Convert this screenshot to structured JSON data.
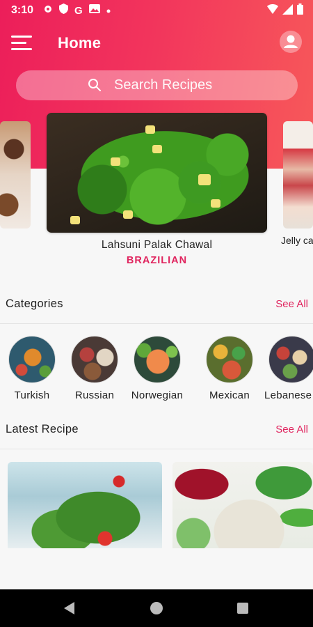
{
  "status_bar": {
    "time": "3:10",
    "icons": [
      "gear-icon",
      "shield-icon",
      "google-icon",
      "image-icon",
      "dot-icon",
      "wifi-icon",
      "signal-icon",
      "battery-icon"
    ]
  },
  "app_bar": {
    "title": "Home"
  },
  "search": {
    "placeholder": "Search Recipes"
  },
  "featured": {
    "current": {
      "name": "Lahsuni Palak Chawal",
      "cuisine": "BRAZILIAN"
    },
    "next": {
      "name": "Jelly cake"
    }
  },
  "categories_section": {
    "title": "Categories",
    "see_all": "See All",
    "items": [
      {
        "label": "Turkish"
      },
      {
        "label": "Russian"
      },
      {
        "label": "Norwegian"
      },
      {
        "label": "Mexican"
      },
      {
        "label": "Lebanese"
      }
    ]
  },
  "latest_section": {
    "title": "Latest Recipe",
    "see_all": "See All"
  },
  "colors": {
    "accent": "#e0245e",
    "header_start": "#ec1e5a",
    "header_end": "#f7595a"
  }
}
